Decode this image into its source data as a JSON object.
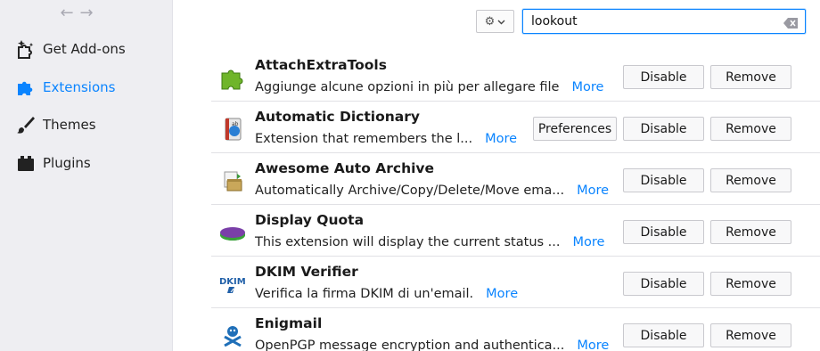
{
  "sidebar": {
    "items": [
      {
        "id": "get-addons",
        "label": "Get Add-ons",
        "icon": "puzzle-sparkle-icon"
      },
      {
        "id": "extensions",
        "label": "Extensions",
        "icon": "puzzle-icon",
        "selected": true
      },
      {
        "id": "themes",
        "label": "Themes",
        "icon": "brush-icon"
      },
      {
        "id": "plugins",
        "label": "Plugins",
        "icon": "plugin-block-icon"
      }
    ]
  },
  "search": {
    "value": "lookout"
  },
  "buttons": {
    "preferences": "Preferences",
    "disable": "Disable",
    "remove": "Remove"
  },
  "addons": [
    {
      "name": "AttachExtraTools",
      "desc": "Aggiunge alcune opzioni in più per allegare file",
      "more": "More",
      "has_prefs": false,
      "icon": "green-puzzle-icon"
    },
    {
      "name": "Automatic Dictionary",
      "desc": "Extension that remembers the l...",
      "more": "More",
      "has_prefs": true,
      "icon": "dictionary-book-icon"
    },
    {
      "name": "Awesome Auto Archive",
      "desc": "Automatically Archive/Copy/Delete/Move ema...",
      "more": "More",
      "has_prefs": false,
      "icon": "archive-box-icon"
    },
    {
      "name": "Display Quota",
      "desc": "This extension will display the current status ...",
      "more": "More",
      "has_prefs": false,
      "icon": "quota-disk-icon"
    },
    {
      "name": "DKIM Verifier",
      "desc": "Verifica la firma DKIM di un'email.",
      "more": "More",
      "has_prefs": false,
      "icon": "dkim-icon"
    },
    {
      "name": "Enigmail",
      "desc": "OpenPGP message encryption and authentica...",
      "more": "More",
      "has_prefs": false,
      "icon": "enigmail-icon"
    }
  ],
  "colors": {
    "accent": "#0a84ff",
    "sidebar_bg": "#eeeef2"
  }
}
